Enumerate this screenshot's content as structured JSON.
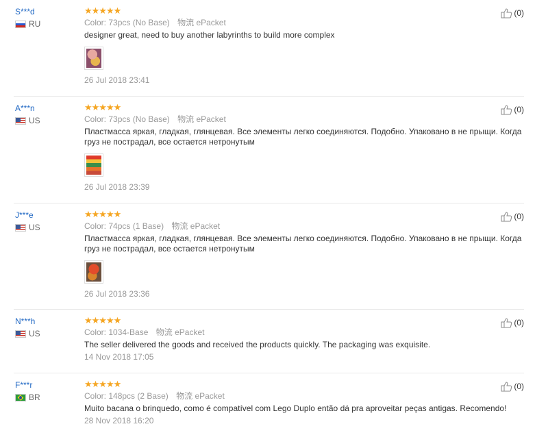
{
  "reviews": [
    {
      "user": "S***d",
      "country": "RU",
      "flag": "ru",
      "stars": "★★★★★",
      "color_label": "Color:",
      "color_value": "73pcs (No Base)",
      "ship_label": "物流",
      "ship_value": "ePacket",
      "text": "designer great, need to buy another labyrinths to build more complex",
      "has_photo": true,
      "date": "26 Jul 2018 23:41",
      "likes": "(0)"
    },
    {
      "user": "A***n",
      "country": "US",
      "flag": "us",
      "stars": "★★★★★",
      "color_label": "Color:",
      "color_value": "73pcs (No Base)",
      "ship_label": "物流",
      "ship_value": "ePacket",
      "text": "Пластмасса яркая, гладкая, глянцевая. Все элементы легко соединяются. Подобно. Упаковано в не прыщи. Когда груз не пострадал, все остается нетронутым",
      "has_photo": true,
      "date": "26 Jul 2018 23:39",
      "likes": "(0)"
    },
    {
      "user": "J***e",
      "country": "US",
      "flag": "us",
      "stars": "★★★★★",
      "color_label": "Color:",
      "color_value": "74pcs (1 Base)",
      "ship_label": "物流",
      "ship_value": "ePacket",
      "text": "Пластмасса яркая, гладкая, глянцевая. Все элементы легко соединяются. Подобно. Упаковано в не прыщи. Когда груз не пострадал, все остается нетронутым",
      "has_photo": true,
      "date": "26 Jul 2018 23:36",
      "likes": "(0)"
    },
    {
      "user": "N***h",
      "country": "US",
      "flag": "us",
      "stars": "★★★★★",
      "color_label": "Color:",
      "color_value": "1034-Base",
      "ship_label": "物流",
      "ship_value": "ePacket",
      "text": "The seller delivered the goods and received the products quickly. The packaging was exquisite.",
      "has_photo": false,
      "date": "14 Nov 2018 17:05",
      "likes": "(0)"
    },
    {
      "user": "F***r",
      "country": "BR",
      "flag": "br",
      "stars": "★★★★★",
      "color_label": "Color:",
      "color_value": "148pcs (2 Base)",
      "ship_label": "物流",
      "ship_value": "ePacket",
      "text": "Muito bacana o brinquedo, como é compatível com Lego Duplo então dá pra aproveitar peças antigas. Recomendo!",
      "has_photo": false,
      "date": "28 Nov 2018 16:20",
      "likes": "(0)"
    }
  ],
  "colors": {
    "user_link": "#2269c4",
    "stars": "#f5a623",
    "muted": "#999999"
  }
}
